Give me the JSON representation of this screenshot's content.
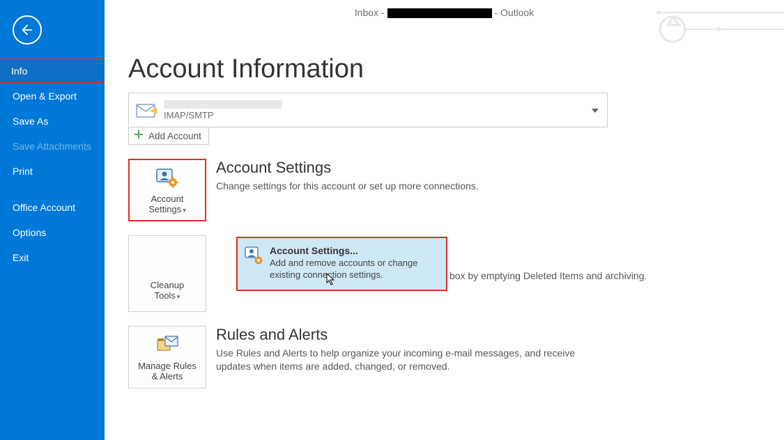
{
  "titlebar": {
    "before": "Inbox - ",
    "after": " - Outlook"
  },
  "sidebar": {
    "info": "Info",
    "open_export": "Open & Export",
    "save_as": "Save As",
    "save_attachments": "Save Attachments",
    "print": "Print",
    "office_account": "Office Account",
    "options": "Options",
    "exit": "Exit"
  },
  "page": {
    "title": "Account Information"
  },
  "account_selector": {
    "protocol": "IMAP/SMTP"
  },
  "add_account": {
    "label": "Add Account"
  },
  "account_settings": {
    "tile_line1": "Account",
    "tile_line2": "Settings",
    "title": "Account Settings",
    "desc": "Change settings for this account or set up more connections."
  },
  "popup": {
    "title": "Account Settings...",
    "desc": "Add and remove accounts or change existing connection settings."
  },
  "mailbox": {
    "tile_line1": "Cleanup",
    "tile_line2": "Tools",
    "tail_desc": "box by emptying Deleted Items and archiving."
  },
  "rules": {
    "tile_line1": "Manage Rules",
    "tile_line2": "& Alerts",
    "title": "Rules and Alerts",
    "desc": "Use Rules and Alerts to help organize your incoming e-mail messages, and receive updates when items are added, changed, or removed."
  }
}
